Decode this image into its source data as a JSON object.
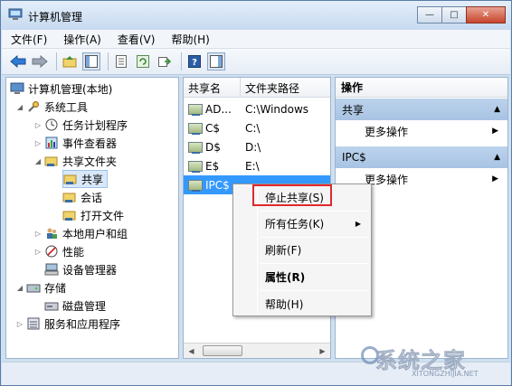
{
  "window": {
    "title": "计算机管理",
    "buttons": {
      "minimize": "—",
      "maximize": "□",
      "close": "✕"
    }
  },
  "menubar": [
    "文件(F)",
    "操作(A)",
    "查看(V)",
    "帮助(H)"
  ],
  "toolbar": {
    "icons": [
      "back-arrow-icon",
      "forward-arrow-icon",
      "up-folder-icon",
      "show-hide-tree-icon",
      "properties-icon",
      "refresh-icon",
      "export-icon",
      "help-icon",
      "show-hide-action-pane-icon"
    ]
  },
  "tree": {
    "root": "计算机管理(本地)",
    "items": [
      {
        "label": "系统工具",
        "level": 1,
        "expanded": true
      },
      {
        "label": "任务计划程序",
        "level": 2
      },
      {
        "label": "事件查看器",
        "level": 2
      },
      {
        "label": "共享文件夹",
        "level": 2,
        "expanded": true
      },
      {
        "label": "共享",
        "level": 3,
        "selected": true
      },
      {
        "label": "会话",
        "level": 3
      },
      {
        "label": "打开文件",
        "level": 3
      },
      {
        "label": "本地用户和组",
        "level": 2
      },
      {
        "label": "性能",
        "level": 2
      },
      {
        "label": "设备管理器",
        "level": 2
      },
      {
        "label": "存储",
        "level": 1,
        "expanded": true
      },
      {
        "label": "磁盘管理",
        "level": 2
      },
      {
        "label": "服务和应用程序",
        "level": 1
      }
    ]
  },
  "list": {
    "columns": [
      "共享名",
      "文件夹路径"
    ],
    "rows": [
      {
        "name": "AD...",
        "path": "C:\\Windows"
      },
      {
        "name": "C$",
        "path": "C:\\"
      },
      {
        "name": "D$",
        "path": "D:\\"
      },
      {
        "name": "E$",
        "path": "E:\\"
      },
      {
        "name": "IPC$",
        "path": "",
        "selected": true
      }
    ]
  },
  "actions": {
    "title": "操作",
    "groups": [
      {
        "label": "共享",
        "item": "更多操作"
      },
      {
        "label": "IPC$",
        "item": "更多操作"
      }
    ]
  },
  "context_menu": {
    "items": [
      "停止共享(S)",
      "所有任务(K)",
      "刷新(F)",
      "属性(R)",
      "帮助(H)"
    ]
  },
  "watermark": {
    "text": "系统之家",
    "sub": "XITONGZHIJIA.NET"
  },
  "colors": {
    "selection": "#3399ff",
    "highlight_box": "#e0282c",
    "action_group": "#bcd3ec"
  }
}
